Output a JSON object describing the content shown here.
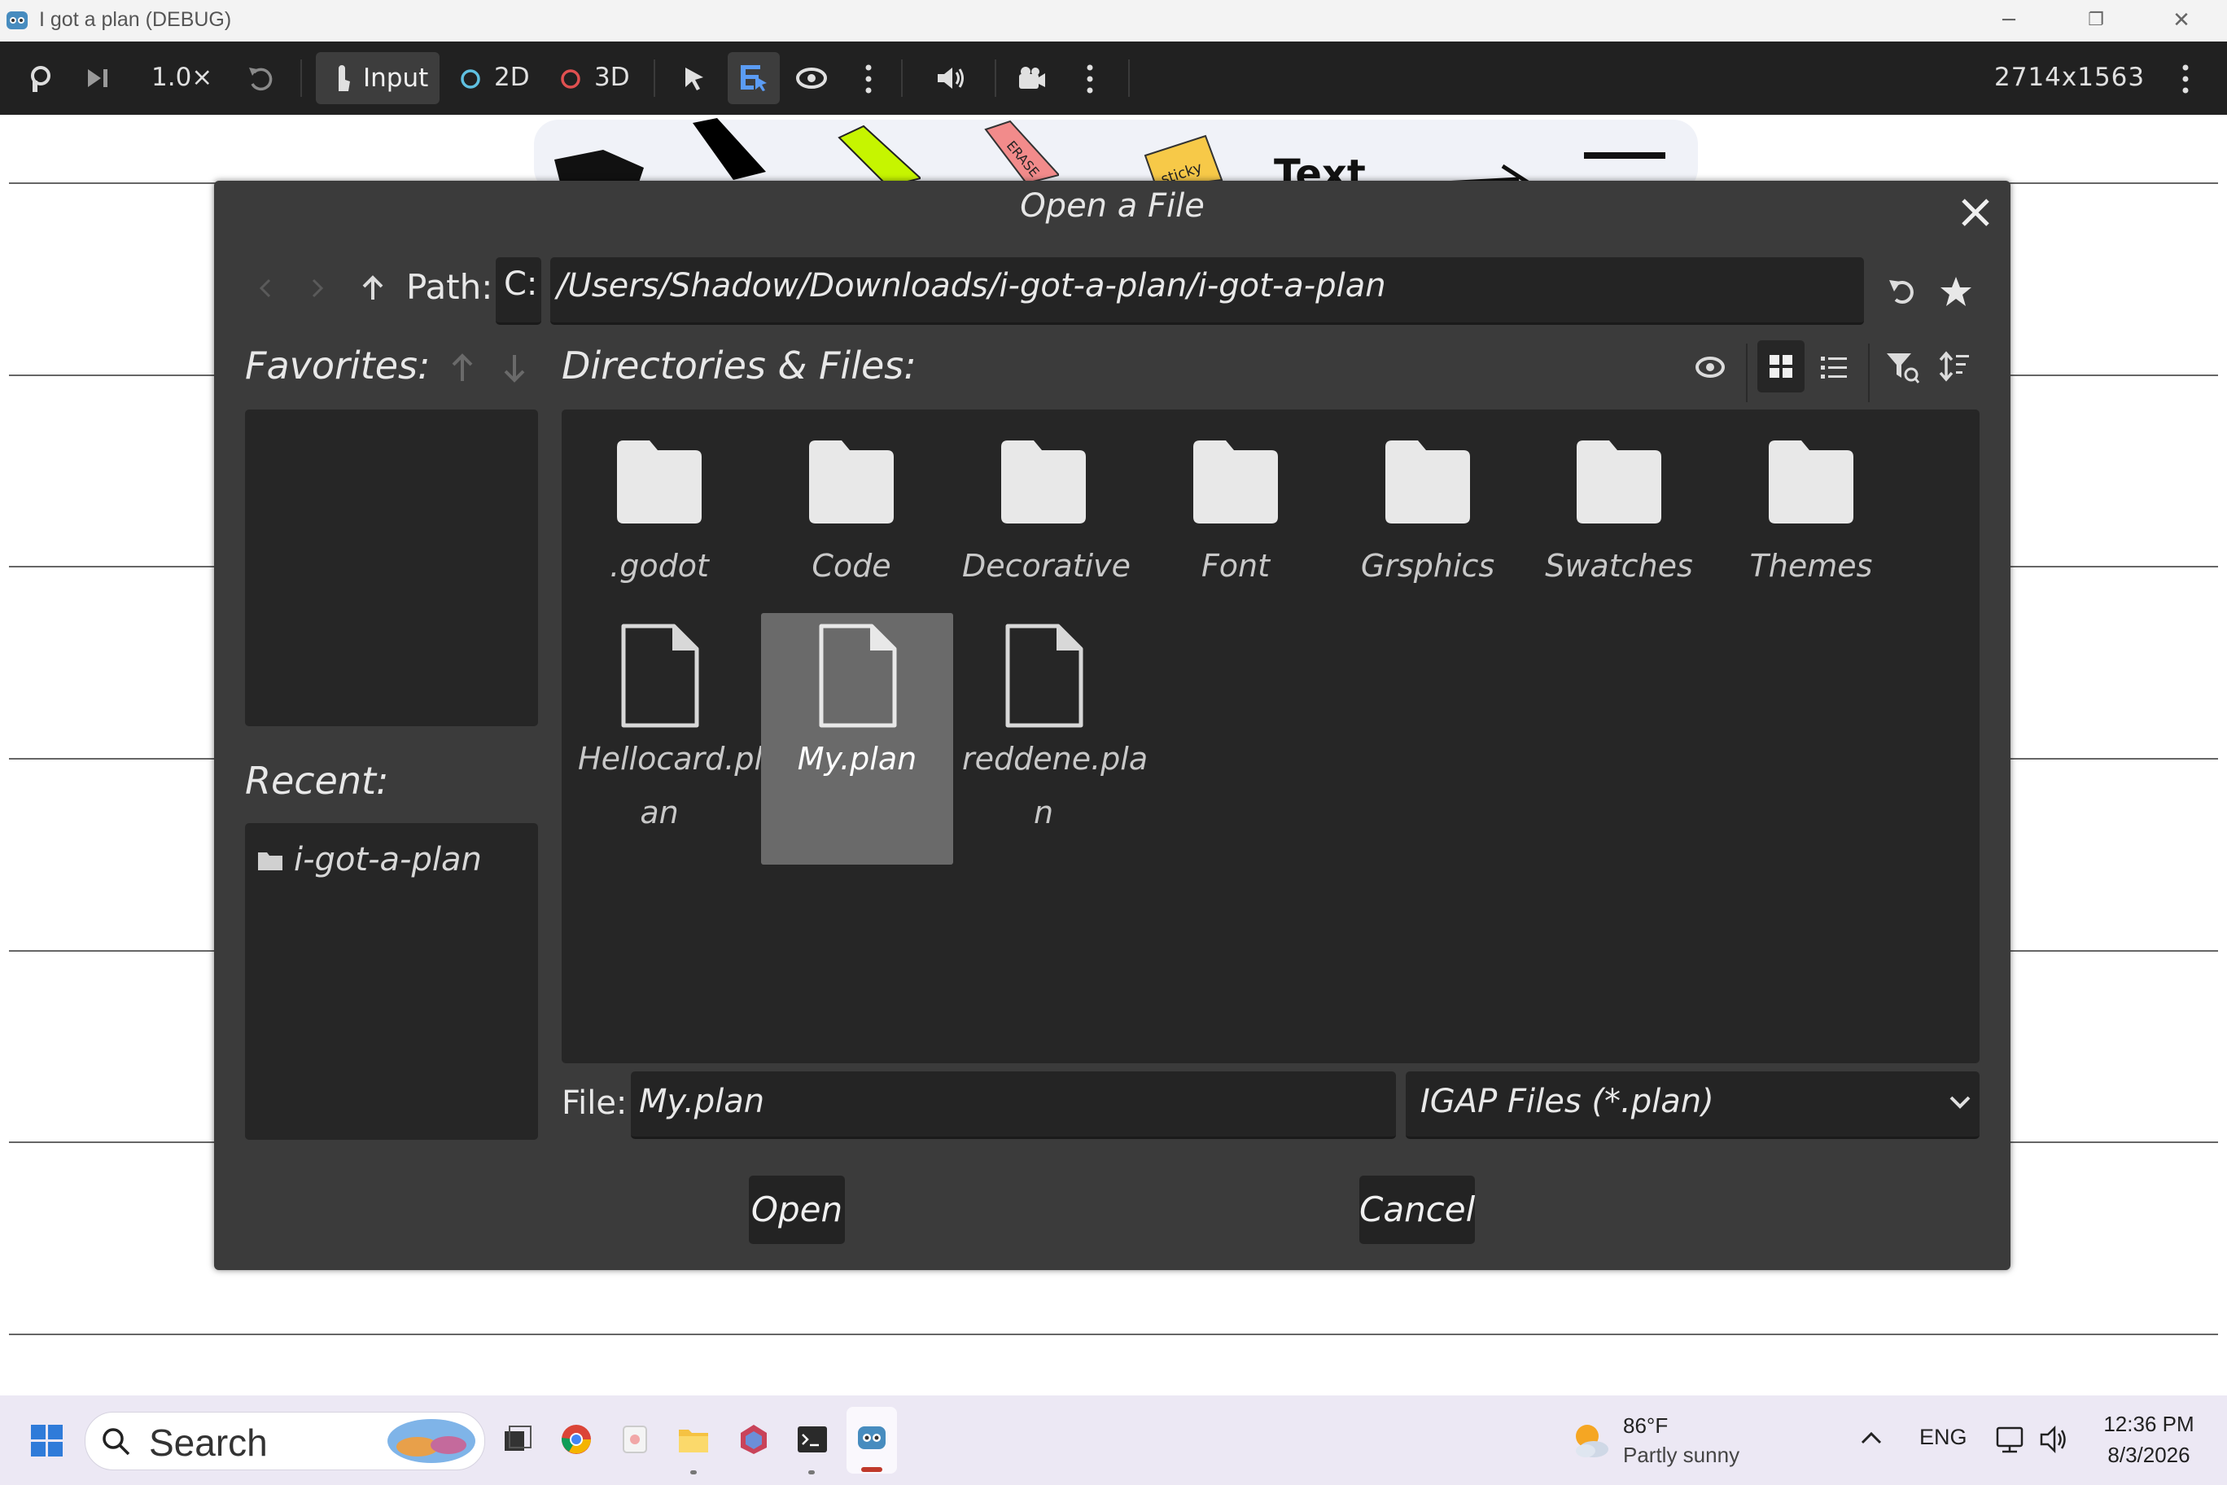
{
  "window": {
    "title": "I got a plan (DEBUG)",
    "minimize": "─",
    "restore": "❐",
    "close": "✕"
  },
  "toolbar": {
    "speed": "1.0×",
    "input_label": "Input",
    "label_2d": "2D",
    "label_3d": "3D",
    "resolution": "2714x1563"
  },
  "dialog": {
    "title": "Open a File",
    "path_label": "Path:",
    "drive": "C:",
    "path": "/Users/Shadow/Downloads/i-got-a-plan/i-got-a-plan",
    "favorites_label": "Favorites:",
    "recent_label": "Recent:",
    "recent_items": [
      "i-got-a-plan"
    ],
    "dir_files_label": "Directories & Files:",
    "folders": [
      ".godot",
      "Code",
      "Decorative",
      "Font",
      "Grsphics",
      "Swatches",
      "Themes"
    ],
    "files": [
      {
        "line1": "Hellocard.pl",
        "line2": "an",
        "selected": false
      },
      {
        "line1": "My.plan",
        "line2": "",
        "selected": true
      },
      {
        "line1": "reddene.pla",
        "line2": "n",
        "selected": false
      }
    ],
    "file_label": "File:",
    "file_value": "My.plan",
    "filter": "IGAP Files (*.plan)",
    "open_button": "Open",
    "cancel_button": "Cancel"
  },
  "taskbar": {
    "search_placeholder": "Search",
    "weather_temp": "86°F",
    "weather_desc": "Partly sunny",
    "language": "ENG",
    "time": "12:36 PM",
    "date": "8/3/2026"
  },
  "colors": {
    "dialog_bg": "#3b3b3b",
    "panel_bg": "#262626",
    "selected_bg": "#6a6a6a",
    "toolbar_bg": "#212121",
    "accent": "#5b9cf5"
  }
}
